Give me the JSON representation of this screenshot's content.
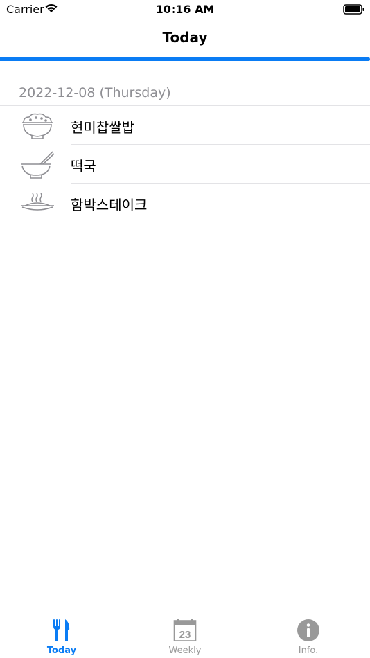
{
  "status_bar": {
    "carrier": "Carrier",
    "time": "10:16 AM"
  },
  "nav": {
    "title": "Today",
    "progress_fraction": 1.0,
    "accent": "#0a7cf4"
  },
  "menu": {
    "date_header": "2022-12-08 (Thursday)",
    "items": [
      {
        "label": "현미찹쌀밥",
        "icon": "rice-bowl-icon"
      },
      {
        "label": "떡국",
        "icon": "soup-bowl-chopsticks-icon"
      },
      {
        "label": "함박스테이크",
        "icon": "hot-plate-icon"
      }
    ]
  },
  "tabs": [
    {
      "label": "Today",
      "icon": "fork-knife-icon",
      "active": true
    },
    {
      "label": "Weekly",
      "icon": "calendar-icon",
      "calendar_day": "23",
      "active": false
    },
    {
      "label": "Info.",
      "icon": "info-icon",
      "active": false
    }
  ],
  "colors": {
    "active": "#0a7cf4",
    "inactive": "#999999",
    "icon_gray": "#8e8e93"
  }
}
